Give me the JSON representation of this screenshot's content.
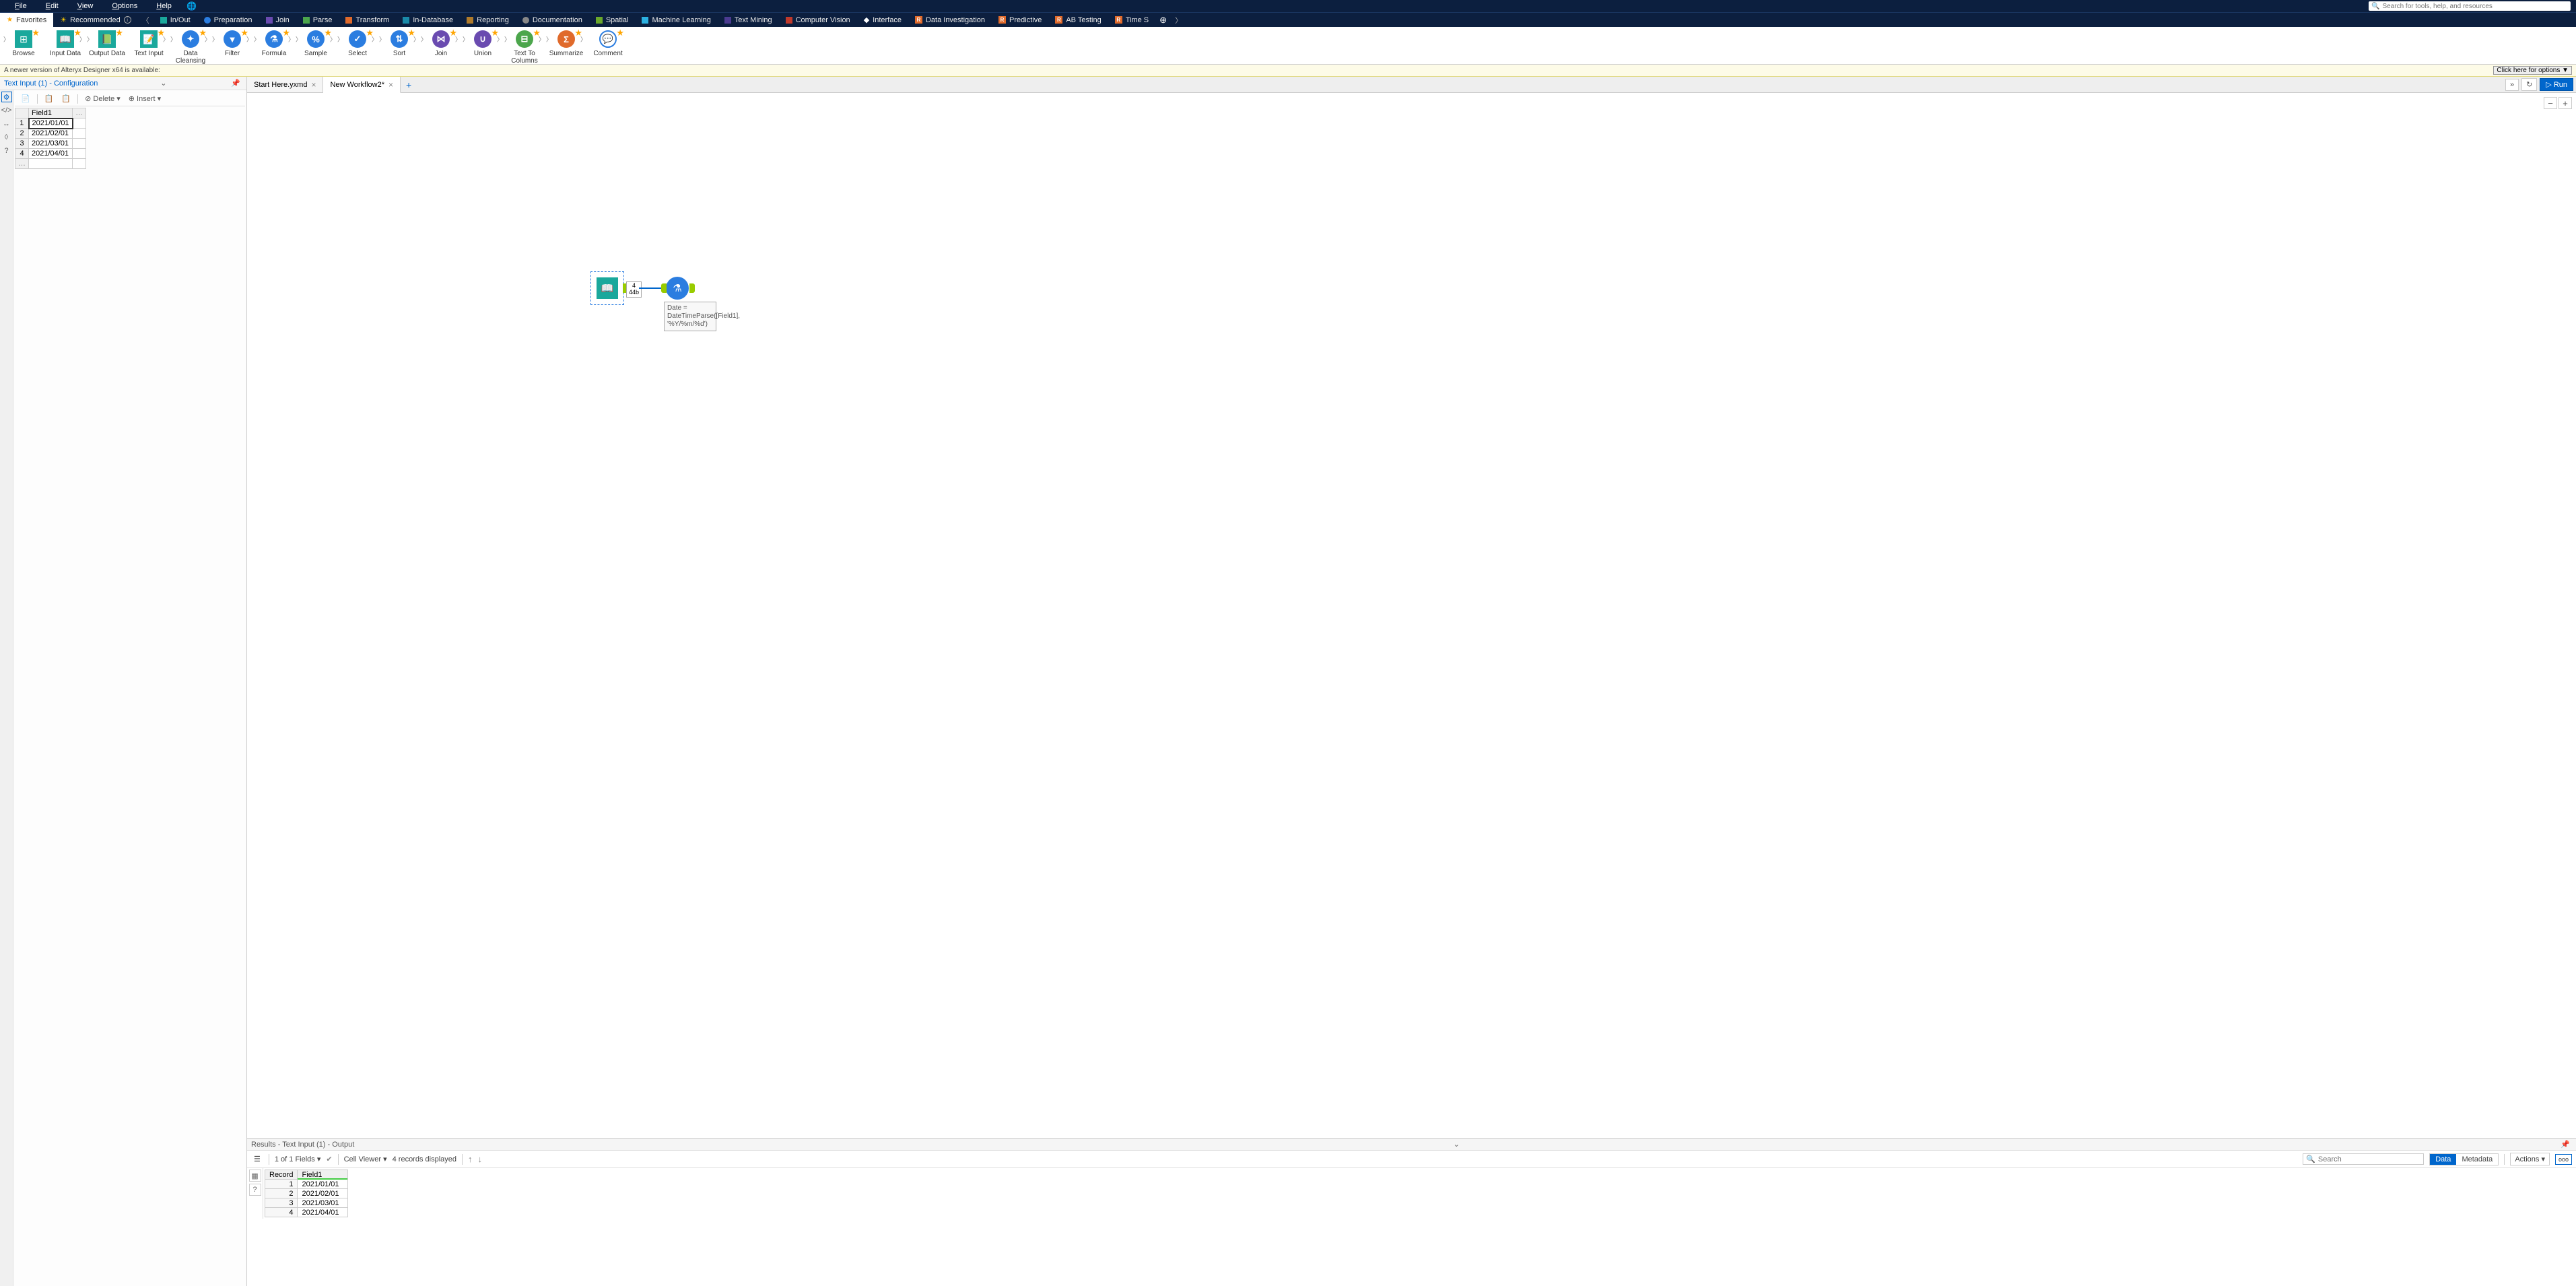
{
  "menu": {
    "file": "File",
    "edit": "Edit",
    "options": "Options",
    "view": "View",
    "help": "Help"
  },
  "search_placeholder": "Search for tools, help, and resources",
  "categories": {
    "favorites": "Favorites",
    "recommended": "Recommended",
    "inout": "In/Out",
    "preparation": "Preparation",
    "join": "Join",
    "parse": "Parse",
    "transform": "Transform",
    "indatabase": "In-Database",
    "reporting": "Reporting",
    "documentation": "Documentation",
    "spatial": "Spatial",
    "ml": "Machine Learning",
    "textmining": "Text Mining",
    "cv": "Computer Vision",
    "interface": "Interface",
    "datainv": "Data Investigation",
    "predictive": "Predictive",
    "abtest": "AB Testing",
    "timeseries": "Time S"
  },
  "tools": {
    "browse": "Browse",
    "inputdata": "Input Data",
    "outputdata": "Output Data",
    "textinput": "Text Input",
    "datacleansing": "Data Cleansing",
    "filter": "Filter",
    "formula": "Formula",
    "sample": "Sample",
    "select": "Select",
    "sort": "Sort",
    "join": "Join",
    "union": "Union",
    "texttocolumns": "Text To Columns",
    "summarize": "Summarize",
    "comment": "Comment"
  },
  "notification": {
    "text": "A newer version of Alteryx Designer x64 is available:",
    "button": "Click here for options ▼"
  },
  "config": {
    "title": "Text Input (1) - Configuration",
    "toolbar": {
      "delete": "Delete",
      "insert": "Insert"
    },
    "header": "Field1",
    "rows": [
      {
        "n": "1",
        "v": "2021/01/01"
      },
      {
        "n": "2",
        "v": "2021/02/01"
      },
      {
        "n": "3",
        "v": "2021/03/01"
      },
      {
        "n": "4",
        "v": "2021/04/01"
      }
    ]
  },
  "workflow_tabs": {
    "tab1": "Start Here.yxmd",
    "tab2": "New Workflow2*"
  },
  "run_button": "Run",
  "canvas": {
    "meta_count": "4",
    "meta_size": "44b",
    "annotation": "Date = DateTimeParse([Field1], '%Y/%m/%d')"
  },
  "results": {
    "title": "Results - Text Input (1) - Output",
    "fields_summary": "1 of 1 Fields",
    "cellviewer": "Cell Viewer",
    "records_displayed": "4 records displayed",
    "search_placeholder": "Search",
    "data": "Data",
    "metadata": "Metadata",
    "actions": "Actions",
    "ooo": "ooo",
    "headers": {
      "record": "Record",
      "field1": "Field1"
    },
    "rows": [
      {
        "n": "1",
        "v": "2021/01/01"
      },
      {
        "n": "2",
        "v": "2021/02/01"
      },
      {
        "n": "3",
        "v": "2021/03/01"
      },
      {
        "n": "4",
        "v": "2021/04/01"
      }
    ]
  }
}
